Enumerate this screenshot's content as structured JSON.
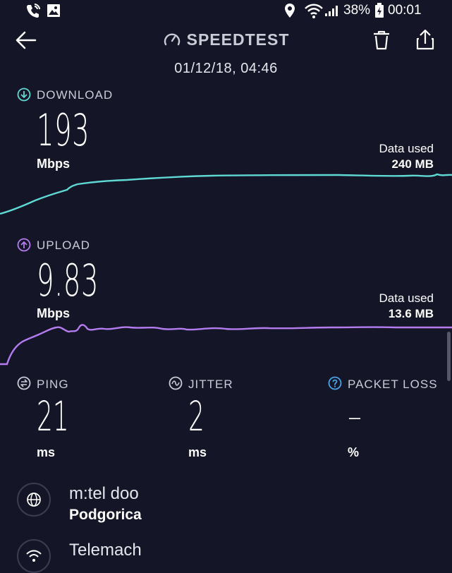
{
  "status_bar": {
    "battery": "38%",
    "time": "00:01",
    "icons": [
      "call-wifi-icon",
      "image-icon",
      "location-icon",
      "wifi-icon",
      "signal-icon",
      "battery-icon"
    ]
  },
  "header": {
    "title": "SPEEDTEST",
    "date": "01/12/18, 04:46"
  },
  "download": {
    "label": "DOWNLOAD",
    "value": "193",
    "unit": "Mbps",
    "data_used_label": "Data used",
    "data_used_value": "240 MB",
    "color": "#5fd9d4"
  },
  "upload": {
    "label": "UPLOAD",
    "value": "9.83",
    "unit": "Mbps",
    "data_used_label": "Data used",
    "data_used_value": "13.6 MB",
    "color": "#b57cf0"
  },
  "metrics": {
    "ping": {
      "label": "PING",
      "value": "21",
      "unit": "ms"
    },
    "jitter": {
      "label": "JITTER",
      "value": "2",
      "unit": "ms"
    },
    "packet_loss": {
      "label": "PACKET LOSS",
      "value": "–",
      "unit": "%"
    }
  },
  "provider": {
    "name": "m:tel doo",
    "location": "Podgorica"
  },
  "connection": {
    "name": "Telemach"
  }
}
